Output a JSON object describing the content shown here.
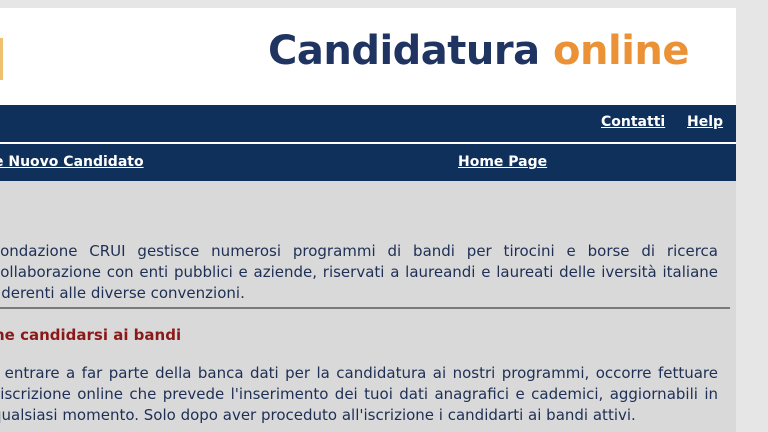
{
  "header": {
    "logo_main": "Candidatura",
    "logo_accent": "online"
  },
  "topnav": {
    "contacts": "Contatti",
    "help": "Help"
  },
  "subnav": {
    "new_candidate": "e Nuovo Candidato",
    "home": "Home Page"
  },
  "content": {
    "intro": "Fondazione CRUI gestisce numerosi programmi di bandi per tirocini e borse di ricerca collaborazione con enti pubblici e aziende, riservati a laureandi e laureati delle iversità italiane aderenti alle diverse convenzioni.",
    "section_title": "ne candidarsi ai bandi",
    "section_text": "r entrare a far parte della banca dati per la candidatura ai nostri programmi, occorre fettuare l'iscrizione online che prevede l'inserimento dei tuoi dati anagrafici e cademici, aggiornabili in qualsiasi momento. Solo dopo aver proceduto all'iscrizione i candidarti ai bandi attivi."
  },
  "colors": {
    "navy": "#10305c",
    "accent_orange": "#ea9235",
    "section_red": "#8a1a1a"
  }
}
